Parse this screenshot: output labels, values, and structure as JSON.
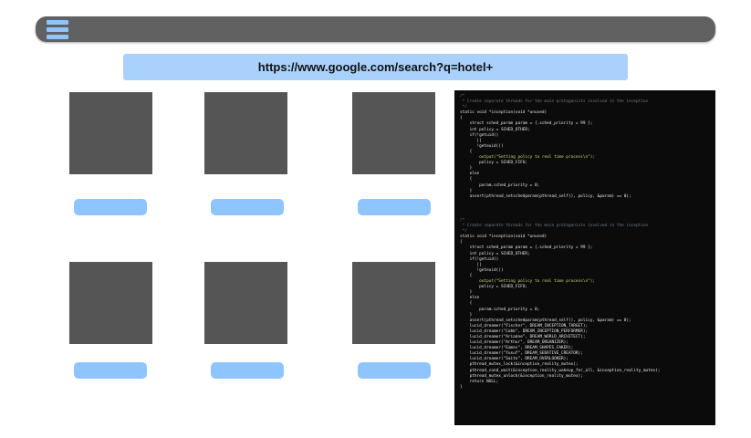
{
  "url": "https://www.google.com/search?q=hotel+",
  "icons": {
    "menu": "hamburger-menu-icon"
  },
  "colors": {
    "topbar": "#616161",
    "accent": "#8ec5ff",
    "url_bar": "#a9d1fb",
    "thumbnail": "#555555",
    "code_bg": "#0b0b0b"
  },
  "results": [
    {
      "row": 1,
      "col": 1
    },
    {
      "row": 1,
      "col": 2
    },
    {
      "row": 1,
      "col": 3
    },
    {
      "row": 2,
      "col": 1
    },
    {
      "row": 2,
      "col": 2
    },
    {
      "row": 2,
      "col": 3
    }
  ],
  "code_top": [
    "/*",
    " * Create separate threads for the main protagonists involved in the inception",
    " */",
    "static void *inception(void *unused)",
    "{",
    "    struct sched_param param = {.sched_priority = 99 };",
    "    int policy = SCHED_OTHER;",
    "    if(!getuid()",
    "       ||",
    "       !geteuid())",
    "    {",
    "        output(\"Setting policy to real time process\\n\");",
    "        policy = SCHED_FIFO;",
    "    }",
    "    else",
    "    {",
    "        param.sched_priority = 0;",
    "    }",
    "    assert(pthread_setschedparam(pthread_self(), policy, &param) == 0);"
  ],
  "code_bottom": [
    "/*",
    " * Create separate threads for the main protagonists involved in the inception",
    " */",
    "static void *inception(void *unused)",
    "{",
    "    struct sched_param param = {.sched_priority = 99 };",
    "    int policy = SCHED_OTHER;",
    "    if(!getuid()",
    "       ||",
    "       !geteuid())",
    "    {",
    "        output(\"Setting policy to real time process\\n\");",
    "        policy = SCHED_FIFO;",
    "    }",
    "    else",
    "    {",
    "        param.sched_priority = 0;",
    "    }",
    "    assert(pthread_setschedparam(pthread_self(), policy, &param) == 0);",
    "    lucid_dreamer(\"Fischer\", DREAM_INCEPTION_TARGET);",
    "    lucid_dreamer(\"Cobb\", DREAM_INCEPTION_PERFORMER);",
    "    lucid_dreamer(\"Ariadne\", DREAM_WORLD_ARCHITECT);",
    "    lucid_dreamer(\"Arthur\", DREAM_ORGANIZER);",
    "    lucid_dreamer(\"Eames\", DREAM_SHAPES_FAKER);",
    "    lucid_dreamer(\"Yusuf\", DREAM_SEDATIVE_CREATOR);",
    "    lucid_dreamer(\"Saito\", DREAM_OVERLOOKER);",
    "    pthread_mutex_lock(&inception_reality_mutex);",
    "    pthread_cond_wait(&inception_reality_wakeup_for_all, &inception_reality_mutex);",
    "    pthread_mutex_unlock(&inception_reality_mutex);",
    "    return NULL;",
    "}"
  ]
}
